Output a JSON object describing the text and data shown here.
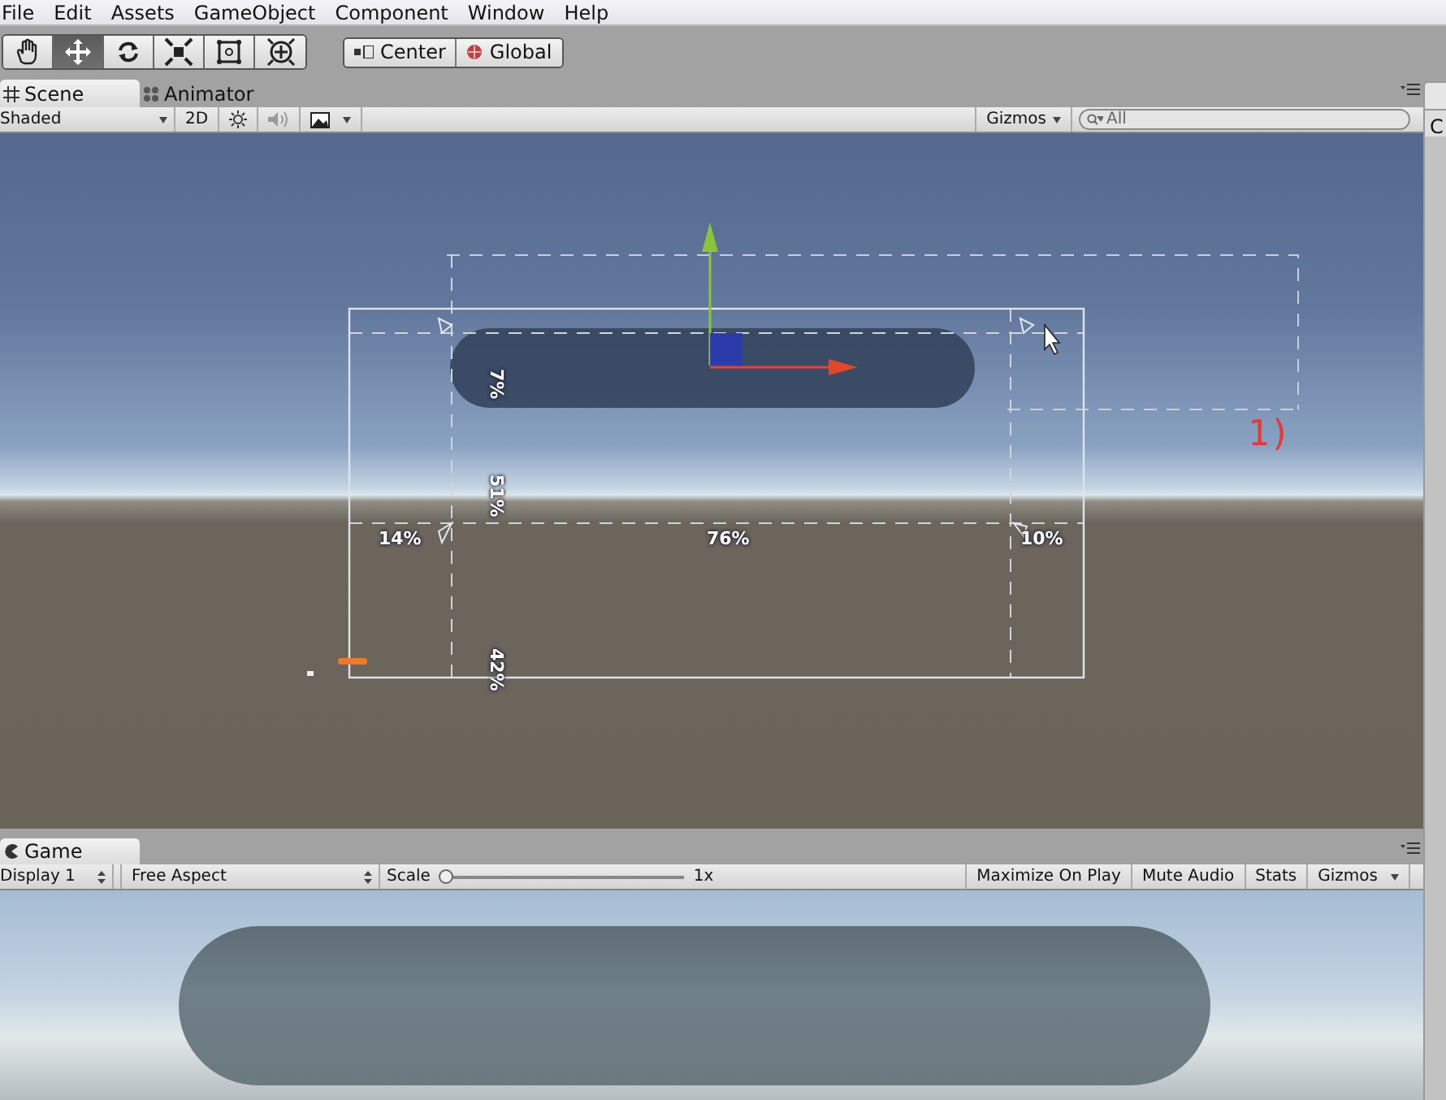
{
  "menu_bar": {
    "items": [
      "File",
      "Edit",
      "Assets",
      "GameObject",
      "Component",
      "Window",
      "Help"
    ]
  },
  "toolbar": {
    "tools": [
      {
        "kind": "hand",
        "selected": false
      },
      {
        "kind": "move",
        "selected": true
      },
      {
        "kind": "rotate",
        "selected": false
      },
      {
        "kind": "scale",
        "selected": false
      },
      {
        "kind": "rect",
        "selected": false
      },
      {
        "kind": "transform",
        "selected": false
      }
    ],
    "pivot_buttons": [
      {
        "kind": "center",
        "label": "Center"
      },
      {
        "kind": "global",
        "label": "Global"
      }
    ]
  },
  "scene_panel": {
    "tabs": [
      {
        "kind": "scene",
        "label": "Scene",
        "selected": true
      },
      {
        "kind": "animator",
        "label": "Animator",
        "selected": false
      }
    ],
    "shading_mode": "Shaded",
    "mode_2d": "2D",
    "lighting_on": true,
    "audio_on": false,
    "gizmos": "Gizmos",
    "search": {
      "value": "All"
    },
    "overlay_labels": [
      {
        "kind": "horizontal",
        "text": "14%"
      },
      {
        "kind": "horizontal",
        "text": "76%"
      },
      {
        "kind": "horizontal",
        "text": "10%"
      },
      {
        "kind": "vertical",
        "text": "7%"
      },
      {
        "kind": "vertical",
        "text": "51%"
      },
      {
        "kind": "vertical",
        "text": "42%"
      }
    ],
    "annotation": "1)"
  },
  "game_panel": {
    "tab": {
      "label": "Game"
    },
    "display": "Display 1",
    "aspect": "Free Aspect",
    "scale": {
      "label": "Scale",
      "level": 0,
      "reading": "1x"
    },
    "buttons": [
      "Maximize On Play",
      "Mute Audio",
      "Stats"
    ],
    "gizmos": "Gizmos"
  },
  "side_panel": {
    "tab_text": "C"
  }
}
